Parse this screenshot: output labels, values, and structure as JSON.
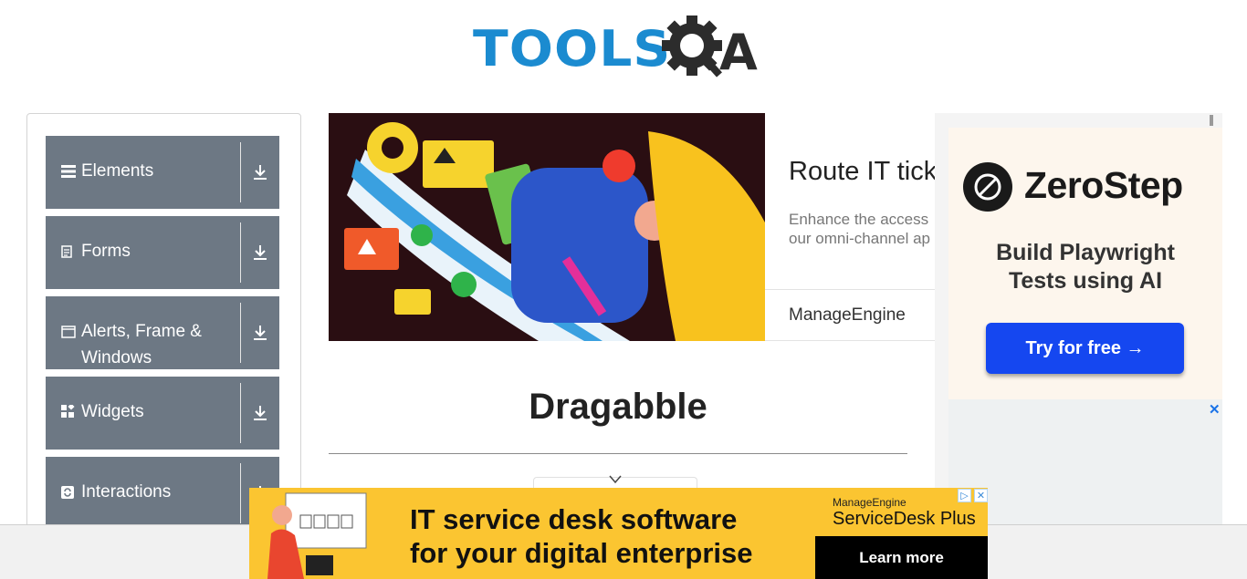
{
  "header": {
    "logo_text": "TOOLS",
    "logo_suffix": "A"
  },
  "sidebar": {
    "groups": [
      {
        "label": "Elements",
        "icon": "hamburger-icon"
      },
      {
        "label": "Forms",
        "icon": "document-icon"
      },
      {
        "label": "Alerts, Frame &",
        "label2": "Windows",
        "icon": "window-icon"
      },
      {
        "label": "Widgets",
        "icon": "widgets-icon"
      },
      {
        "label": "Interactions",
        "icon": "refresh-icon"
      }
    ],
    "download_icon": "download-icon"
  },
  "center_ad": {
    "title": "Route IT tick",
    "desc_line1": "Enhance the access",
    "desc_line2": "our omni-channel ap",
    "brand": "ManageEngine"
  },
  "main": {
    "page_title": "Dragabble"
  },
  "right_ad": {
    "brand_name": "ZeroStep",
    "headline_line1": "Build Playwright",
    "headline_line2": "Tests using AI",
    "cta": "Try for free →",
    "close": "✕"
  },
  "bottom_banner": {
    "line1": "IT service desk software",
    "line2": "for your digital enterprise",
    "brand_small": "ManageEngine",
    "brand_product": "ServiceDesk Plus",
    "cta": "Learn more",
    "ad_choices": "▷",
    "ad_close": "✕"
  },
  "colors": {
    "group_bg": "#6d7884",
    "logo_blue": "#1b8bd0",
    "cta_blue": "#1547f0",
    "banner_yellow": "#fbc531"
  }
}
